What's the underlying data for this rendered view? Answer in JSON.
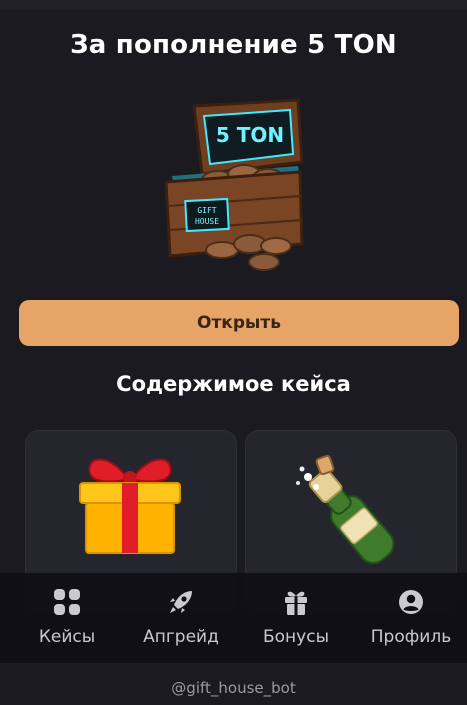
{
  "case": {
    "title": "За пополнение 5 TON",
    "chest_sign": "5 TON",
    "chest_plate_line1": "GIFT",
    "chest_plate_line2": "HOUSE",
    "open_label": "Открыть"
  },
  "contents": {
    "title": "Содержимое кейса",
    "items": [
      {
        "icon": "gift-box-icon"
      },
      {
        "icon": "champagne-bottle-icon"
      }
    ]
  },
  "nav": {
    "items": [
      {
        "label": "Кейсы",
        "icon": "grid-icon"
      },
      {
        "label": "Апгрейд",
        "icon": "rocket-icon"
      },
      {
        "label": "Бонусы",
        "icon": "gift-icon"
      },
      {
        "label": "Профиль",
        "icon": "profile-icon"
      }
    ]
  },
  "footer": {
    "handle": "@gift_house_bot"
  },
  "colors": {
    "background": "#1a1a20",
    "button": "#e6a466",
    "button_text": "#3a2414",
    "card": "#25252d",
    "nav_bg": "#0f0f13",
    "neon": "#43e8ff"
  }
}
